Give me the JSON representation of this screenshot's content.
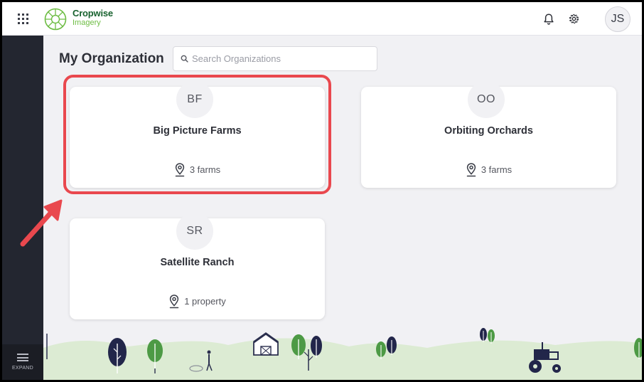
{
  "app": {
    "brand_name": "Cropwise",
    "brand_sub": "Imagery"
  },
  "header": {
    "user_initials": "JS"
  },
  "sidebar": {
    "expand_label": "EXPAND"
  },
  "main": {
    "title": "My Organization",
    "search": {
      "placeholder": "Search Organizations",
      "value": ""
    },
    "organizations": [
      {
        "initials": "BF",
        "name": "Big Picture Farms",
        "meta": "3 farms",
        "highlighted": true
      },
      {
        "initials": "OO",
        "name": "Orbiting Orchards",
        "meta": "3 farms",
        "highlighted": false
      },
      {
        "initials": "SR",
        "name": "Satellite Ranch",
        "meta": "1 property",
        "highlighted": false
      }
    ]
  },
  "colors": {
    "brand_dark_green": "#18622f",
    "brand_light_green": "#6ebd44",
    "sidebar": "#232630",
    "annotation_red": "#e9484e",
    "hill_green": "#dcebd3"
  },
  "icons": [
    "apps-grid-icon",
    "cropwise-logo-icon",
    "bell-icon",
    "gear-icon",
    "search-icon",
    "location-pin-icon",
    "hamburger-menu-icon"
  ]
}
